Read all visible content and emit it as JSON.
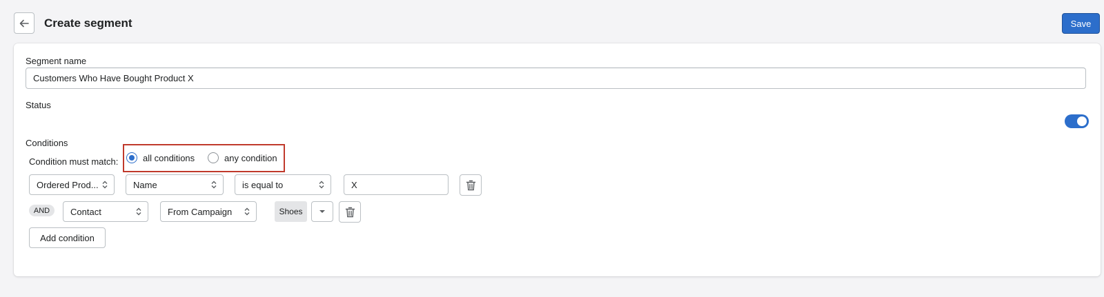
{
  "header": {
    "back_icon": "arrow-left-icon",
    "title": "Create segment",
    "save_label": "Save"
  },
  "form": {
    "segment_name_label": "Segment name",
    "segment_name_value": "Customers Who Have Bought Product X",
    "status_label": "Status",
    "status_enabled": true,
    "conditions_label": "Conditions",
    "match_label": "Condition must match:",
    "match_options": [
      {
        "label": "all conditions",
        "selected": true
      },
      {
        "label": "any condition",
        "selected": false
      }
    ]
  },
  "conditions": [
    {
      "connector": "",
      "field": "Ordered Prod...",
      "attribute": "Name",
      "operator": "is equal to",
      "value": "X",
      "delete_icon": "trash-icon"
    },
    {
      "connector": "AND",
      "field": "Contact",
      "attribute": "From Campaign",
      "tag": "Shoes",
      "dropdown_icon": "caret-down-icon",
      "delete_icon": "trash-icon"
    }
  ],
  "add_condition_label": "Add condition",
  "colors": {
    "primary": "#2c6ecb",
    "highlight_border": "#c0392b",
    "background": "#f4f4f6"
  }
}
